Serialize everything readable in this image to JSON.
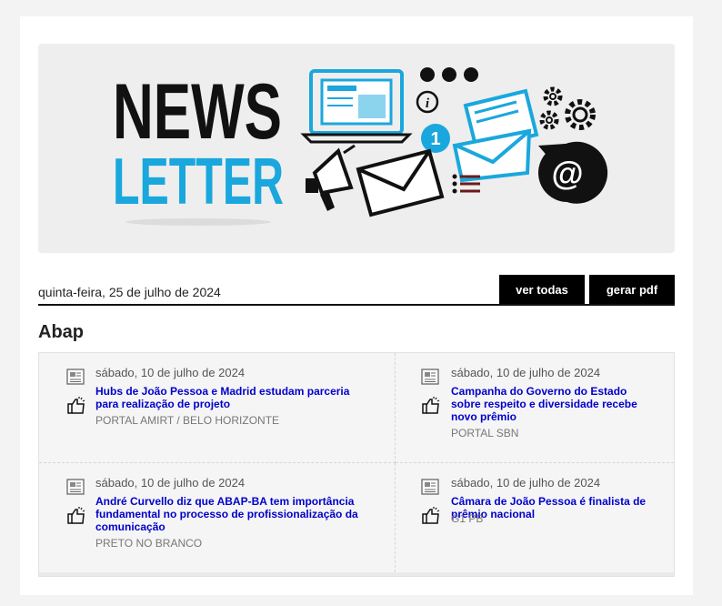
{
  "banner": {
    "word1": "NEWS",
    "word2": "LETTER",
    "colors": {
      "dark": "#111111",
      "accent": "#1aa7dd",
      "bg": "#eeeeee"
    },
    "icons": [
      "laptop-icon",
      "info-icon",
      "dots-icon",
      "notification-badge-icon",
      "envelope-icon",
      "open-letter-icon",
      "gears-icon",
      "megaphone-icon",
      "list-icon",
      "at-sign-icon"
    ],
    "badge_number": "1"
  },
  "header": {
    "date": "quinta-feira, 25 de julho de 2024",
    "view_all_label": "ver todas",
    "pdf_label": "gerar pdf"
  },
  "section": {
    "title": "Abap",
    "items": [
      {
        "date": "sábado, 10 de julho de 2024",
        "title": "Hubs de João Pessoa e Madrid estudam parceria para realização de projeto",
        "source": "PORTAL AMIRT / BELO HORIZONTE"
      },
      {
        "date": "sábado, 10 de julho de 2024",
        "title": "Campanha do Governo do Estado sobre respeito e diversidade recebe novo prêmio",
        "source": "PORTAL SBN"
      },
      {
        "date": "sábado, 10 de julho de 2024",
        "title": "André Curvello diz que ABAP-BA tem importância fundamental no processo de profissionalização da comunicação",
        "source": "PRETO NO BRANCO"
      },
      {
        "date": "sábado, 10 de julho de 2024",
        "title": "Câmara de João Pessoa é finalista de prêmio nacional",
        "source": "G1 PB"
      }
    ]
  }
}
